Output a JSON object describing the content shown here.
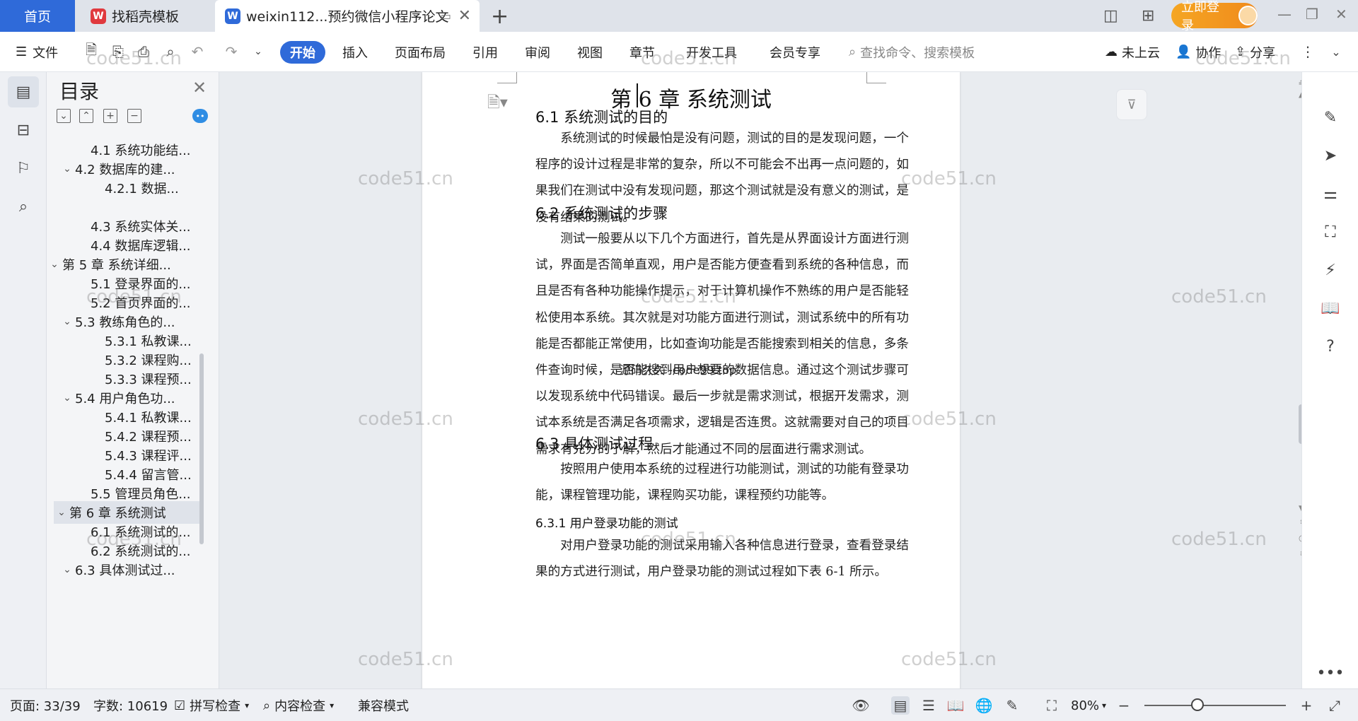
{
  "tabs": {
    "home": "首页",
    "template": "找稻壳模板",
    "doc": "weixin112...预约微信小程序论文"
  },
  "account": {
    "login": "立即登录"
  },
  "ribbon": {
    "file": "文件",
    "start": "开始",
    "insert": "插入",
    "layout": "页面布局",
    "reference": "引用",
    "review": "审阅",
    "view": "视图",
    "chapter": "章节",
    "devtools": "开发工具",
    "member": "会员专享",
    "search_placeholder": "查找命令、搜索模板",
    "cloud": "未上云",
    "collab": "协作",
    "share": "分享"
  },
  "toc": {
    "title": "目录",
    "items": [
      {
        "label": "4.1  系统功能结...",
        "expand": ""
      },
      {
        "label": "4.2  数据库的建...",
        "expand": "⌄"
      },
      {
        "label": "4.2.1  数据...",
        "expand": ""
      },
      {
        "label": "4.3 系统实体关...",
        "expand": ""
      },
      {
        "label": "4.4 数据库逻辑...",
        "expand": ""
      },
      {
        "label": "第 5 章  系统详细...",
        "expand": "⌄"
      },
      {
        "label": "5.1 登录界面的...",
        "expand": ""
      },
      {
        "label": "5.2 首页界面的...",
        "expand": ""
      },
      {
        "label": "5.3 教练角色的...",
        "expand": "⌄"
      },
      {
        "label": "5.3.1 私教课...",
        "expand": ""
      },
      {
        "label": "5.3.2 课程购...",
        "expand": ""
      },
      {
        "label": "5.3.3 课程预...",
        "expand": ""
      },
      {
        "label": "5.4 用户角色功...",
        "expand": "⌄"
      },
      {
        "label": "5.4.1 私教课...",
        "expand": ""
      },
      {
        "label": "5.4.2 课程预...",
        "expand": ""
      },
      {
        "label": "5.4.3 课程评...",
        "expand": ""
      },
      {
        "label": "5.4.4 留言管...",
        "expand": ""
      },
      {
        "label": "5.5 管理员角色...",
        "expand": ""
      },
      {
        "label": "第 6 章   系统测试",
        "expand": "⌄"
      },
      {
        "label": "6.1 系统测试的...",
        "expand": ""
      },
      {
        "label": "6.2 系统测试的...",
        "expand": ""
      },
      {
        "label": "6.3 具体测试过...",
        "expand": "⌄"
      }
    ]
  },
  "document": {
    "chapter_title": "第 6 章   系统测试",
    "s61_title": "6.1 系统测试的目的",
    "s61_body": "系统测试的时候最怕是没有问题，测试的目的是发现问题，一个程序的设计过程是非常的复杂，所以不可能会不出再一点问题的，如果我们在测试中没有发现问题，那这个测试就是没有意义的测试，是没有结果的测试。",
    "s62_title": "6.2 系统测试的步骤",
    "s62_body": "测试一般要从以下几个方面进行，首先是从界面设计方面进行测试，界面是否简单直观，用户是否能方便查看到系统的各种信息，而且是否有各种功能操作提示，对于计算机操作不熟练的用户是否能轻松使用本系统。其次就是对功能方面进行测试，测试系统中的所有功能是否都能正常使用，比如查询功能是否能搜索到相关的信息，多条件查询时候，是否能搜到用户想要的数据信息。通过这个测试步骤可以发现系统中代码错误。最后一步就是需求测试，根据开发需求，测试本系统是否满足各项需求，逻辑是否连贯。这就需要对自己的项目需求有充分的了解，然后才能通过不同的层面进行需求测试。",
    "s63_title": "6.3 具体测试过程",
    "s63_body": "按照用户使用本系统的过程进行功能测试，测试的功能有登录功能，课程管理功能，课程购买功能，课程预约功能等。",
    "s631_title": "6.3.1 用户登录功能的测试",
    "s631_body": "对用户登录功能的测试采用输入各种信息进行登录，查看登录结果的方式进行测试，用户登录功能的测试过程如下表 6-1 所示。"
  },
  "watermarks": {
    "text": "code51.cn",
    "center_text": "源码久久 -code99.top"
  },
  "status": {
    "page": "页面: 33/39",
    "words": "字数: 10619",
    "spell": "拼写检查",
    "content": "内容检查",
    "compat": "兼容模式",
    "zoom": "80%"
  },
  "colors": {
    "accent": "#2f6ad9",
    "login": "#f5a623",
    "tabbar": "#dfe3ea"
  }
}
